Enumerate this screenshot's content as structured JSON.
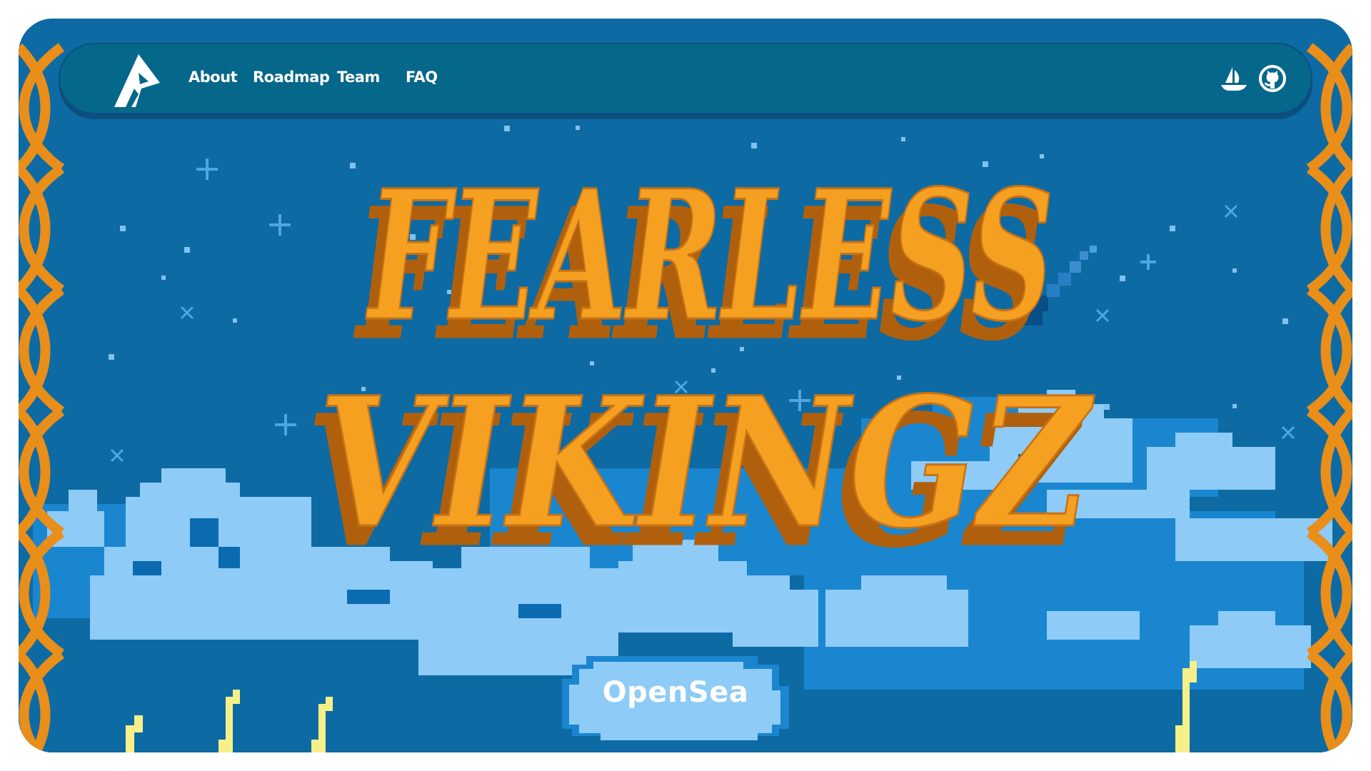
{
  "nav": {
    "links": [
      {
        "label": "About"
      },
      {
        "label": "Roadmap"
      },
      {
        "label": "Team"
      },
      {
        "label": "FAQ"
      }
    ],
    "icons": [
      "opensea-icon",
      "github-icon"
    ]
  },
  "hero": {
    "title_line1": "FEARLESS",
    "title_line2": "VIKINGZ",
    "cta_label": "OpenSea"
  },
  "colors": {
    "sky": "#0e6aa3",
    "nav": "#05678a",
    "title_light": "#f6a024",
    "title_dark": "#b8640a",
    "cloud_light": "#8ecbf6",
    "cloud_mid": "#1a86cf",
    "border_gold": "#e98e19",
    "lightning": "#f7f08a"
  }
}
